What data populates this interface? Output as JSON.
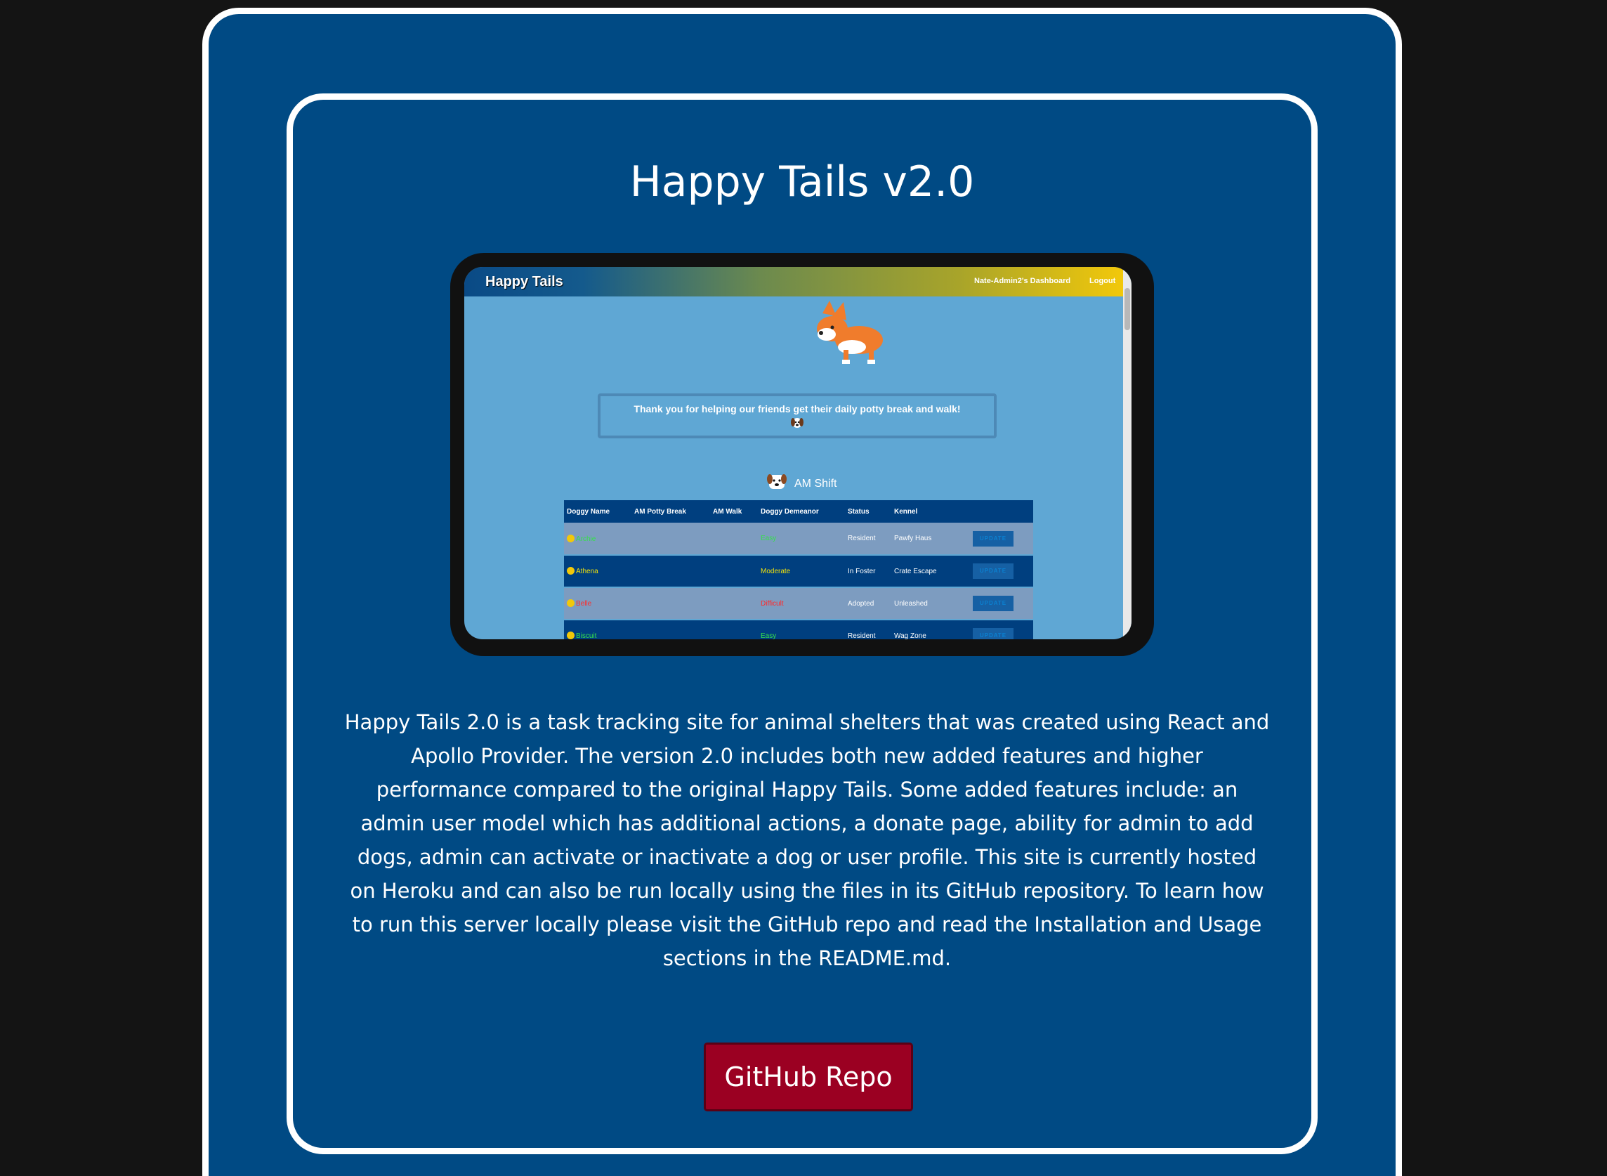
{
  "project": {
    "title": "Happy Tails v2.0",
    "description": "Happy Tails 2.0 is a task tracking site for animal shelters that was created using React and Apollo Provider. The version 2.0 includes both new added features and higher performance compared to the original Happy Tails. Some added features include: an admin user model which has additional actions, a donate page, ability for admin to add dogs, admin can activate or inactivate a dog or user profile. This site is currently hosted on Heroku and can also be run locally using the files in its GitHub repository. To learn how to run this server locally please visit the GitHub repo and read the Installation and Usage sections in the README.md.",
    "repo_button_label": "GitHub Repo"
  },
  "screenshot": {
    "brand": "Happy Tails",
    "nav_links": [
      "Nate-Admin2's Dashboard",
      "Logout"
    ],
    "thanks_message": "Thank you for helping our friends get their daily potty break and walk!",
    "shift_label": "AM Shift",
    "table_headers": [
      "Doggy Name",
      "AM Potty Break",
      "AM Walk",
      "Doggy Demeanor",
      "Status",
      "Kennel",
      ""
    ],
    "rows": [
      {
        "name": "Archie",
        "demeanor": "Easy",
        "status": "Resident",
        "kennel": "Pawfy Haus",
        "action": "UPDATE"
      },
      {
        "name": "Athena",
        "demeanor": "Moderate",
        "status": "In Foster",
        "kennel": "Crate Escape",
        "action": "UPDATE"
      },
      {
        "name": "Belle",
        "demeanor": "Difficult",
        "status": "Adopted",
        "kennel": "Unleashed",
        "action": "UPDATE"
      },
      {
        "name": "Biscuit",
        "demeanor": "Easy",
        "status": "Resident",
        "kennel": "Wag Zone",
        "action": "UPDATE"
      }
    ]
  },
  "colors": {
    "page_background": "#141414",
    "card_background": "#004a84",
    "border": "#ffffff",
    "button": "#9b0022",
    "easy": "#35e04a",
    "moderate": "#f2e20a",
    "difficult": "#ff2a2a"
  }
}
